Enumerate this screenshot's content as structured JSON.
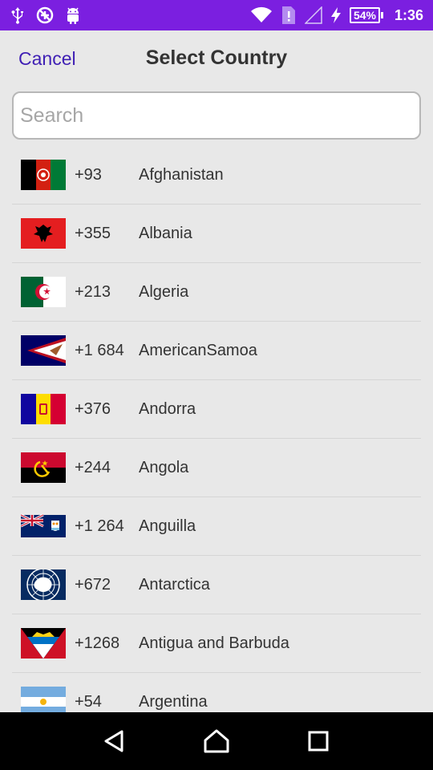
{
  "status_bar": {
    "battery": "54%",
    "time": "1:36"
  },
  "header": {
    "cancel_label": "Cancel",
    "title": "Select Country"
  },
  "search": {
    "placeholder": "Search"
  },
  "countries": [
    {
      "code": "+93",
      "name": "Afghanistan"
    },
    {
      "code": "+355",
      "name": "Albania"
    },
    {
      "code": "+213",
      "name": "Algeria"
    },
    {
      "code": "+1 684",
      "name": "AmericanSamoa"
    },
    {
      "code": "+376",
      "name": "Andorra"
    },
    {
      "code": "+244",
      "name": "Angola"
    },
    {
      "code": "+1 264",
      "name": "Anguilla"
    },
    {
      "code": "+672",
      "name": "Antarctica"
    },
    {
      "code": "+1268",
      "name": "Antigua and Barbuda"
    },
    {
      "code": "+54",
      "name": "Argentina"
    }
  ],
  "colors": {
    "status_bar": "#7b1fe0",
    "accent": "#3f1fb4"
  }
}
